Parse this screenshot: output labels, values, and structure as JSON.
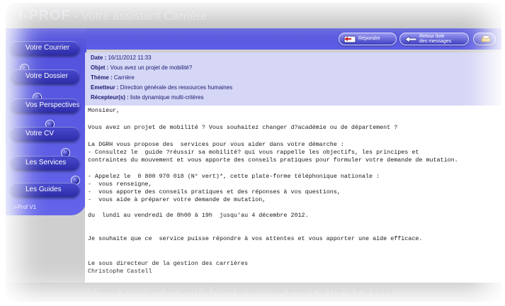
{
  "app": {
    "title_prefix": "i-PROF",
    "title_rest": " - Votre assistant Carrière"
  },
  "sidebar": {
    "items": [
      {
        "label": "Votre Courrier"
      },
      {
        "label": "Votre Dossier"
      },
      {
        "label": "Vos Perspectives"
      },
      {
        "label": "Votre CV"
      },
      {
        "label": "Les Services"
      },
      {
        "label": "Les Guides"
      }
    ],
    "footer": "i-Prof V1"
  },
  "toolbar": {
    "reply_label": "Répondre",
    "back_label": "Retour liste\ndes messages",
    "print_icon": "print-icon"
  },
  "message": {
    "date_label": "Date :",
    "date_value": " 16/11/2012 11:33",
    "subject_label": "Objet :",
    "subject_value": " Vous avez un projet de mobilité?",
    "theme_label": "Thème :",
    "theme_value": " Carrière",
    "sender_label": "Emetteur :",
    "sender_value": " Direction générale des ressources humaines",
    "recipients_label": "Récepteur(s) :",
    "recipients_value": " liste dynamique multi-critères",
    "body": [
      "Monsieur,",
      "Vous avez un projet de mobilité ? Vous souhaitez changer d?académie ou de département ?",
      "La DGRH vous propose des  services pour vous aider dans votre démarche :",
      "- Consultez le  guide ?réussir sa mobilité? qui vous rappelle les objectifs, les principes et",
      "contraintes du mouvement et vous apporte des conseils pratiques pour formuler votre demande de mutation.",
      "- Appelez le  0 800 970 018 (N° vert)*, cette plate-forme téléphonique nationale :",
      "-  vous renseigne,",
      "-  vous apporte des conseils pratiques et des réponses à vos questions,",
      "-  vous aide à préparer votre demande de mutation,",
      "du  lundi au vendredi de 8h00 à 19h  jusqu'au 4 décembre 2012.",
      "Je souhaite que ce  service puisse répondre à vos attentes et vous apporter une aide efficace.",
      "Le sous directeur de la gestion des carrières",
      "Christophe Castell",
      "* numéro gratuit pour les appels de France métropolitaine passés d'un fixe ou d'un mobile"
    ]
  },
  "colors": {
    "accent": "#4a4ad8",
    "header_panel": "#d6d6f6",
    "meta_text": "#1a1a70"
  }
}
